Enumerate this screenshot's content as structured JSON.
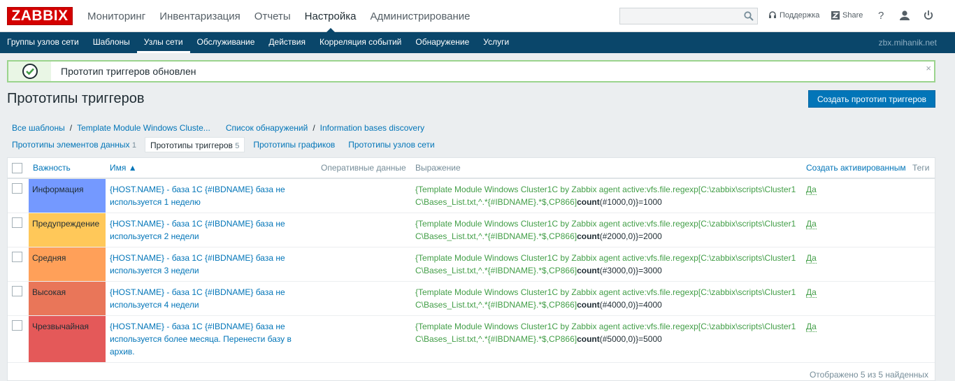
{
  "logo": "ZABBIX",
  "main_menu": [
    "Мониторинг",
    "Инвентаризация",
    "Отчеты",
    "Настройка",
    "Администрирование"
  ],
  "main_menu_active": 3,
  "search": {
    "value": "",
    "placeholder": ""
  },
  "top_links": {
    "support": "Поддержка",
    "share": "Share",
    "help": "?"
  },
  "sub_menu": [
    "Группы узлов сети",
    "Шаблоны",
    "Узлы сети",
    "Обслуживание",
    "Действия",
    "Корреляция событий",
    "Обнаружение",
    "Услуги"
  ],
  "sub_menu_active": 2,
  "server": "zbx.mihanik.net",
  "message": {
    "text": "Прототип триггеров обновлен",
    "close": "×"
  },
  "page_title": "Прототипы триггеров",
  "create_button": "Создать прототип триггеров",
  "breadcrumbs": [
    "Все шаблоны",
    "Template Module Windows Cluste...",
    "Список обнаружений",
    "Information bases discovery"
  ],
  "tabs": [
    {
      "label": "Прототипы элементов данных",
      "count": "1"
    },
    {
      "label": "Прототипы триггеров",
      "count": "5"
    },
    {
      "label": "Прототипы графиков",
      "count": ""
    },
    {
      "label": "Прототипы узлов сети",
      "count": ""
    }
  ],
  "tabs_active": 1,
  "table": {
    "headers": {
      "severity": "Важность",
      "name": "Имя ▲",
      "opdata": "Оперативные данные",
      "expression": "Выражение",
      "create_enabled": "Создать активированным",
      "tags": "Теги"
    },
    "rows": [
      {
        "severity": "Информация",
        "color": "#7499ff",
        "name": "{HOST.NAME} - база 1С {#IBDNAME} база не используется 1 неделю",
        "expr_item": "{Template Module Windows Cluster1C by Zabbix agent active:vfs.file.regexp[C:\\zabbix\\scripts\\Cluster1C\\Bases_List.txt,^.*{#IBDNAME}.*$,CP866]",
        "expr_fn": "count",
        "expr_tail": "(#1000,0)}=1000",
        "create_enabled": "Да"
      },
      {
        "severity": "Предупреждение",
        "color": "#ffc859",
        "name": "{HOST.NAME} - база 1С {#IBDNAME} база не используется 2 недели",
        "expr_item": "{Template Module Windows Cluster1C by Zabbix agent active:vfs.file.regexp[C:\\zabbix\\scripts\\Cluster1C\\Bases_List.txt,^.*{#IBDNAME}.*$,CP866]",
        "expr_fn": "count",
        "expr_tail": "(#2000,0)}=2000",
        "create_enabled": "Да"
      },
      {
        "severity": "Средняя",
        "color": "#ffa059",
        "name": "{HOST.NAME} - база 1С {#IBDNAME} база не используется 3 недели",
        "expr_item": "{Template Module Windows Cluster1C by Zabbix agent active:vfs.file.regexp[C:\\zabbix\\scripts\\Cluster1C\\Bases_List.txt,^.*{#IBDNAME}.*$,CP866]",
        "expr_fn": "count",
        "expr_tail": "(#3000,0)}=3000",
        "create_enabled": "Да"
      },
      {
        "severity": "Высокая",
        "color": "#e97659",
        "name": "{HOST.NAME} - база 1С {#IBDNAME} база не используется 4 недели",
        "expr_item": "{Template Module Windows Cluster1C by Zabbix agent active:vfs.file.regexp[C:\\zabbix\\scripts\\Cluster1C\\Bases_List.txt,^.*{#IBDNAME}.*$,CP866]",
        "expr_fn": "count",
        "expr_tail": "(#4000,0)}=4000",
        "create_enabled": "Да"
      },
      {
        "severity": "Чрезвычайная",
        "color": "#e45959",
        "name": "{HOST.NAME} - база 1С {#IBDNAME} база не используется более месяца. Перенести базу в архив.",
        "expr_item": "{Template Module Windows Cluster1C by Zabbix agent active:vfs.file.regexp[C:\\zabbix\\scripts\\Cluster1C\\Bases_List.txt,^.*{#IBDNAME}.*$,CP866]",
        "expr_fn": "count",
        "expr_tail": "(#5000,0)}=5000",
        "create_enabled": "Да"
      }
    ]
  },
  "footer": "Отображено 5 из 5 найденных"
}
